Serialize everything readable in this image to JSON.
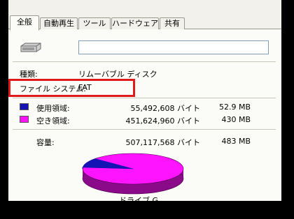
{
  "tabs": [
    "全般",
    "自動再生",
    "ツール",
    "ハードウェア",
    "共有"
  ],
  "drive_name_value": "",
  "type_label": "種類:",
  "type_value": "リムーバブル ディスク",
  "fs_label": "ファイル システム:",
  "fs_value": "FAT",
  "used": {
    "label": "使用領域:",
    "bytes": "55,492,608 バイト",
    "size": "52.9 MB",
    "color": "#1414b4"
  },
  "free": {
    "label": "空き領域:",
    "bytes": "451,624,960 バイト",
    "size": "430 MB",
    "color": "#ff14ff"
  },
  "capacity": {
    "label": "容量:",
    "bytes": "507,117,568 バイト",
    "size": "483 MB"
  },
  "drive_label": "ドライブ G",
  "highlight_color": "#e0191b"
}
